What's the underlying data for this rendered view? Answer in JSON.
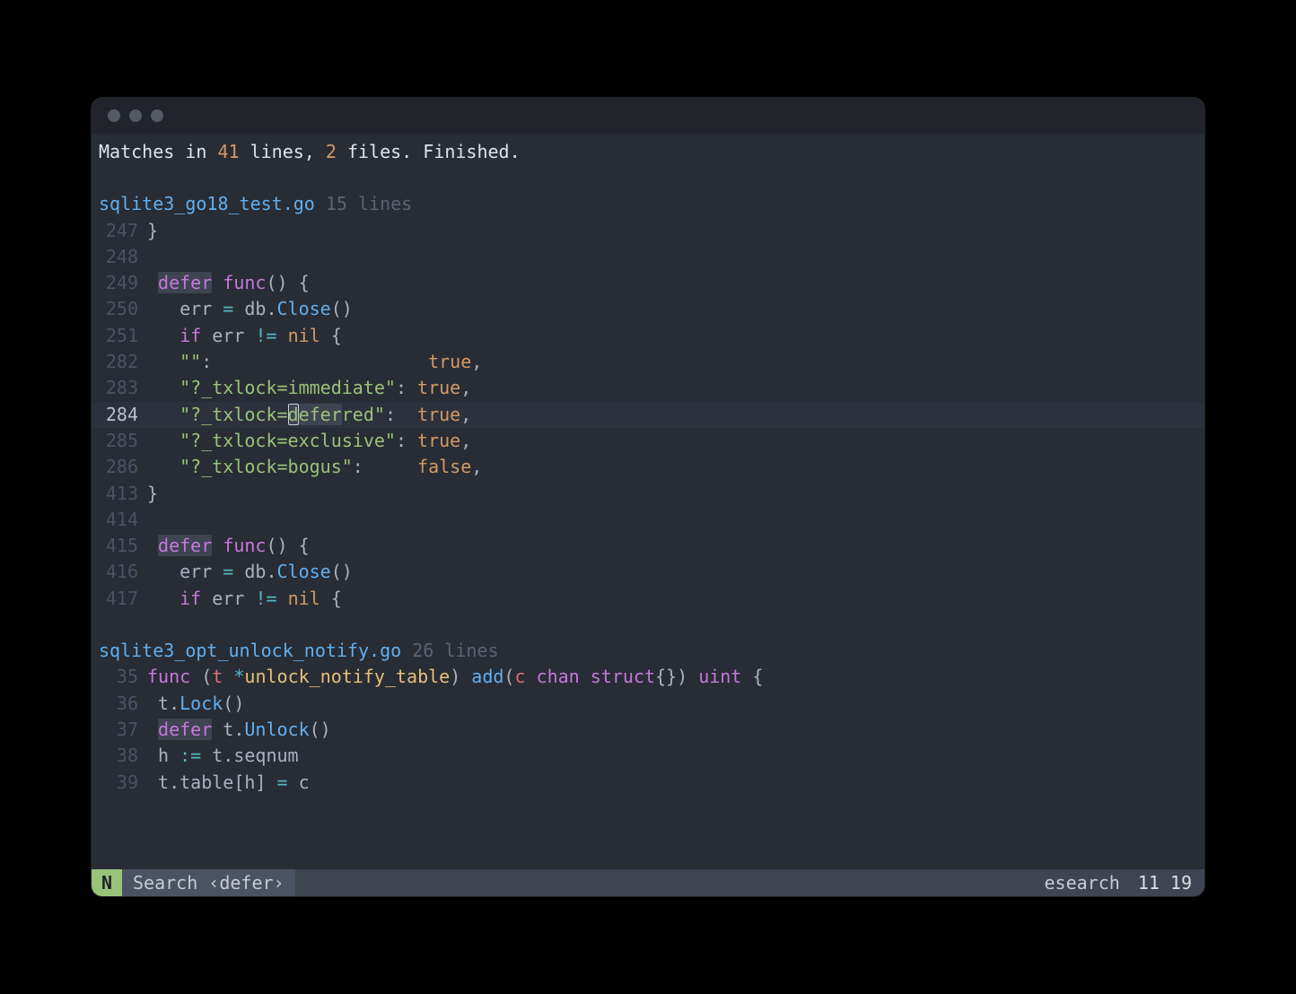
{
  "summary": {
    "prefix": "Matches in ",
    "line_count": "41",
    "mid1": " lines, ",
    "file_count": "2",
    "suffix": " files. Finished."
  },
  "files": [
    {
      "name": "sqlite3_go18_test.go",
      "line_label": "15 lines",
      "lines": [
        {
          "num": "247",
          "active": false,
          "hl": false,
          "tokens": [
            {
              "t": "}",
              "c": "c-default"
            }
          ]
        },
        {
          "num": "248",
          "active": false,
          "hl": false,
          "tokens": [
            {
              "t": "",
              "c": "c-default"
            }
          ]
        },
        {
          "num": "249",
          "active": false,
          "hl": false,
          "tokens": [
            {
              "t": " ",
              "c": "c-default"
            },
            {
              "t": "defer",
              "c": "c-purple",
              "hl": true
            },
            {
              "t": " ",
              "c": "c-default"
            },
            {
              "t": "func",
              "c": "c-purple"
            },
            {
              "t": "() {",
              "c": "c-default"
            }
          ]
        },
        {
          "num": "250",
          "active": false,
          "hl": false,
          "tokens": [
            {
              "t": "   err ",
              "c": "c-default"
            },
            {
              "t": "=",
              "c": "c-teal"
            },
            {
              "t": " db.",
              "c": "c-default"
            },
            {
              "t": "Close",
              "c": "c-blue"
            },
            {
              "t": "()",
              "c": "c-default"
            }
          ]
        },
        {
          "num": "251",
          "active": false,
          "hl": false,
          "tokens": [
            {
              "t": "   ",
              "c": "c-default"
            },
            {
              "t": "if",
              "c": "c-purple"
            },
            {
              "t": " err ",
              "c": "c-default"
            },
            {
              "t": "!=",
              "c": "c-teal"
            },
            {
              "t": " ",
              "c": "c-default"
            },
            {
              "t": "nil",
              "c": "c-orange"
            },
            {
              "t": " {",
              "c": "c-default"
            }
          ]
        },
        {
          "num": "282",
          "active": false,
          "hl": false,
          "tokens": [
            {
              "t": "   ",
              "c": "c-default"
            },
            {
              "t": "\"\"",
              "c": "c-green"
            },
            {
              "t": ":                    ",
              "c": "c-default"
            },
            {
              "t": "true",
              "c": "c-orange"
            },
            {
              "t": ",",
              "c": "c-default"
            }
          ]
        },
        {
          "num": "283",
          "active": false,
          "hl": false,
          "tokens": [
            {
              "t": "   ",
              "c": "c-default"
            },
            {
              "t": "\"?_txlock=immediate\"",
              "c": "c-green"
            },
            {
              "t": ": ",
              "c": "c-default"
            },
            {
              "t": "true",
              "c": "c-orange"
            },
            {
              "t": ",",
              "c": "c-default"
            }
          ]
        },
        {
          "num": "284",
          "active": true,
          "hl": true,
          "tokens": [
            {
              "t": "   ",
              "c": "c-default"
            },
            {
              "t": "\"?_txlock=",
              "c": "c-green"
            },
            {
              "t": "d",
              "c": "c-green",
              "hl": true,
              "cursor": true
            },
            {
              "t": "efer",
              "c": "c-green",
              "hl": true
            },
            {
              "t": "red\"",
              "c": "c-green"
            },
            {
              "t": ":  ",
              "c": "c-default"
            },
            {
              "t": "true",
              "c": "c-orange"
            },
            {
              "t": ",",
              "c": "c-default"
            }
          ]
        },
        {
          "num": "285",
          "active": false,
          "hl": false,
          "tokens": [
            {
              "t": "   ",
              "c": "c-default"
            },
            {
              "t": "\"?_txlock=exclusive\"",
              "c": "c-green"
            },
            {
              "t": ": ",
              "c": "c-default"
            },
            {
              "t": "true",
              "c": "c-orange"
            },
            {
              "t": ",",
              "c": "c-default"
            }
          ]
        },
        {
          "num": "286",
          "active": false,
          "hl": false,
          "tokens": [
            {
              "t": "   ",
              "c": "c-default"
            },
            {
              "t": "\"?_txlock=bogus\"",
              "c": "c-green"
            },
            {
              "t": ":     ",
              "c": "c-default"
            },
            {
              "t": "false",
              "c": "c-orange"
            },
            {
              "t": ",",
              "c": "c-default"
            }
          ]
        },
        {
          "num": "413",
          "active": false,
          "hl": false,
          "tokens": [
            {
              "t": "}",
              "c": "c-default"
            }
          ]
        },
        {
          "num": "414",
          "active": false,
          "hl": false,
          "tokens": [
            {
              "t": "",
              "c": "c-default"
            }
          ]
        },
        {
          "num": "415",
          "active": false,
          "hl": false,
          "tokens": [
            {
              "t": " ",
              "c": "c-default"
            },
            {
              "t": "defer",
              "c": "c-purple",
              "hl": true
            },
            {
              "t": " ",
              "c": "c-default"
            },
            {
              "t": "func",
              "c": "c-purple"
            },
            {
              "t": "() {",
              "c": "c-default"
            }
          ]
        },
        {
          "num": "416",
          "active": false,
          "hl": false,
          "tokens": [
            {
              "t": "   err ",
              "c": "c-default"
            },
            {
              "t": "=",
              "c": "c-teal"
            },
            {
              "t": " db.",
              "c": "c-default"
            },
            {
              "t": "Close",
              "c": "c-blue"
            },
            {
              "t": "()",
              "c": "c-default"
            }
          ]
        },
        {
          "num": "417",
          "active": false,
          "hl": false,
          "tokens": [
            {
              "t": "   ",
              "c": "c-default"
            },
            {
              "t": "if",
              "c": "c-purple"
            },
            {
              "t": " err ",
              "c": "c-default"
            },
            {
              "t": "!=",
              "c": "c-teal"
            },
            {
              "t": " ",
              "c": "c-default"
            },
            {
              "t": "nil",
              "c": "c-orange"
            },
            {
              "t": " {",
              "c": "c-default"
            }
          ]
        }
      ]
    },
    {
      "name": "sqlite3_opt_unlock_notify.go",
      "line_label": "26 lines",
      "lines": [
        {
          "num": "35",
          "active": false,
          "hl": false,
          "tokens": [
            {
              "t": "func",
              "c": "c-purple"
            },
            {
              "t": " (",
              "c": "c-default"
            },
            {
              "t": "t",
              "c": "c-red"
            },
            {
              "t": " ",
              "c": "c-default"
            },
            {
              "t": "*",
              "c": "c-teal"
            },
            {
              "t": "unlock_notify_table",
              "c": "c-yellow"
            },
            {
              "t": ") ",
              "c": "c-default"
            },
            {
              "t": "add",
              "c": "c-blue"
            },
            {
              "t": "(",
              "c": "c-default"
            },
            {
              "t": "c",
              "c": "c-red"
            },
            {
              "t": " ",
              "c": "c-default"
            },
            {
              "t": "chan",
              "c": "c-purple"
            },
            {
              "t": " ",
              "c": "c-default"
            },
            {
              "t": "struct",
              "c": "c-purple"
            },
            {
              "t": "{}) ",
              "c": "c-default"
            },
            {
              "t": "uint",
              "c": "c-purple"
            },
            {
              "t": " {",
              "c": "c-default"
            }
          ]
        },
        {
          "num": "36",
          "active": false,
          "hl": false,
          "tokens": [
            {
              "t": " t.",
              "c": "c-default"
            },
            {
              "t": "Lock",
              "c": "c-blue"
            },
            {
              "t": "()",
              "c": "c-default"
            }
          ]
        },
        {
          "num": "37",
          "active": false,
          "hl": false,
          "tokens": [
            {
              "t": " ",
              "c": "c-default"
            },
            {
              "t": "defer",
              "c": "c-purple",
              "hl": true
            },
            {
              "t": " t.",
              "c": "c-default"
            },
            {
              "t": "Unlock",
              "c": "c-blue"
            },
            {
              "t": "()",
              "c": "c-default"
            }
          ]
        },
        {
          "num": "38",
          "active": false,
          "hl": false,
          "tokens": [
            {
              "t": " h ",
              "c": "c-default"
            },
            {
              "t": ":=",
              "c": "c-teal"
            },
            {
              "t": " t.seqnum",
              "c": "c-default"
            }
          ]
        },
        {
          "num": "39",
          "active": false,
          "hl": false,
          "tokens": [
            {
              "t": " t.table[h] ",
              "c": "c-default"
            },
            {
              "t": "=",
              "c": "c-teal"
            },
            {
              "t": " c",
              "c": "c-default"
            }
          ]
        }
      ]
    }
  ],
  "status": {
    "mode": "N",
    "title": "Search ‹defer›",
    "mode_name": "esearch",
    "pos": "11 19"
  }
}
